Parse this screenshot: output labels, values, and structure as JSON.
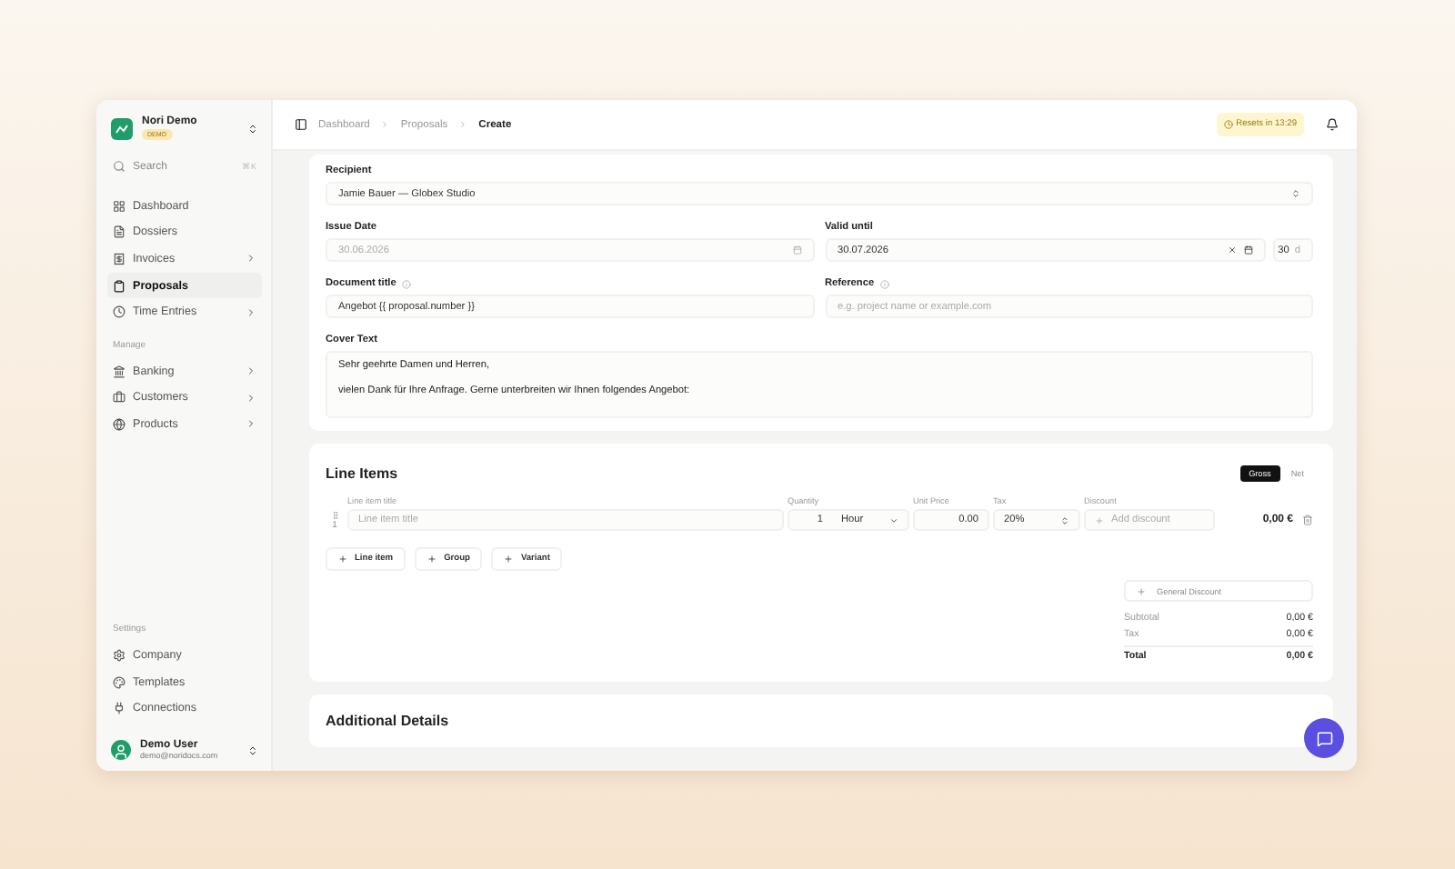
{
  "workspace": {
    "name": "Nori Demo",
    "badge": "DEMO"
  },
  "search": {
    "placeholder": "Search",
    "shortcut": "⌘K"
  },
  "nav_sections": [
    {
      "items": [
        {
          "label": "Dashboard",
          "selected": false,
          "expandable": false
        },
        {
          "label": "Dossiers",
          "selected": false,
          "expandable": false
        },
        {
          "label": "Invoices",
          "selected": false,
          "expandable": true
        },
        {
          "label": "Proposals",
          "selected": true,
          "expandable": false
        },
        {
          "label": "Time Entries",
          "selected": false,
          "expandable": true
        }
      ]
    },
    {
      "title": "Manage",
      "items": [
        {
          "label": "Banking",
          "selected": false,
          "expandable": true
        },
        {
          "label": "Customers",
          "selected": false,
          "expandable": true
        },
        {
          "label": "Products",
          "selected": false,
          "expandable": true
        }
      ]
    }
  ],
  "settings_section": {
    "title": "Settings",
    "items": [
      {
        "label": "Company",
        "selected": false,
        "expandable": false
      },
      {
        "label": "Templates",
        "selected": false,
        "expandable": false
      },
      {
        "label": "Connections",
        "selected": false,
        "expandable": false
      }
    ]
  },
  "user": {
    "name": "Demo User",
    "email": "demo@noridocs.com"
  },
  "breadcrumbs": [
    {
      "label": "Dashboard",
      "current": false
    },
    {
      "label": "Proposals",
      "current": false
    },
    {
      "label": "Create",
      "current": true
    }
  ],
  "reset_badge": "Resets in 13:29",
  "form": {
    "recipient": {
      "label": "Recipient",
      "value": "Jamie Bauer — Globex Studio"
    },
    "issue_date": {
      "label": "Issue Date",
      "placeholder": "30.06.2026"
    },
    "valid_until": {
      "label": "Valid until",
      "value": "30.07.2026",
      "days": "30",
      "unit": "d"
    },
    "document_title": {
      "label": "Document title",
      "value": "Angebot {{ proposal.number }}"
    },
    "reference": {
      "label": "Reference",
      "placeholder": "e.g. project name or example.com"
    },
    "cover_text": {
      "label": "Cover Text",
      "paragraphs": [
        "Sehr geehrte Damen und Herren,",
        "vielen Dank für Ihre Anfrage. Gerne unterbreiten wir Ihnen folgendes Angebot:"
      ]
    }
  },
  "line_items": {
    "title": "Line Items",
    "pricing_modes": [
      {
        "label": "Gross",
        "selected": true
      },
      {
        "label": "Net",
        "selected": false
      }
    ],
    "columns": {
      "title": "Line item title",
      "quantity": "Quantity",
      "unit_price": "Unit Price",
      "tax": "Tax",
      "discount": "Discount"
    },
    "rows": [
      {
        "number": "1",
        "title_placeholder": "Line item title",
        "quantity": "1",
        "unit": "Hour",
        "unit_price": "0.00",
        "tax": "20%",
        "discount": "Add discount",
        "total": "0,00 €"
      }
    ],
    "add_buttons": [
      "Line item",
      "Group",
      "Variant"
    ],
    "general_discount": "General Discount",
    "totals": [
      {
        "label": "Subtotal",
        "value": "0,00 €",
        "kind": "normal"
      },
      {
        "label": "Tax",
        "value": "0,00 €",
        "kind": "normal"
      },
      {
        "label": "Total",
        "value": "0,00 €",
        "kind": "total"
      }
    ]
  },
  "additional_details": {
    "title": "Additional Details"
  }
}
